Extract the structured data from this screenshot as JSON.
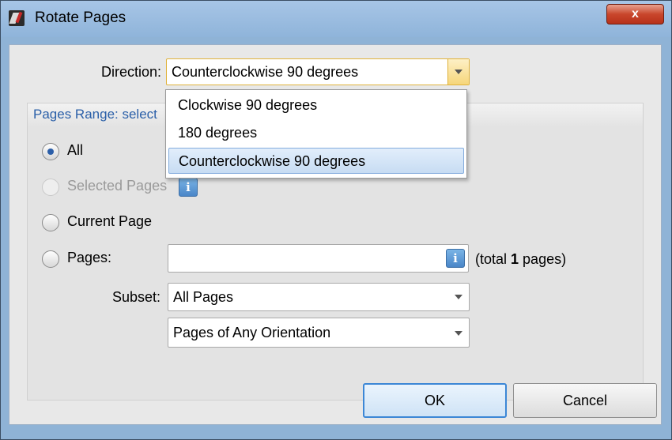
{
  "window": {
    "title": "Rotate Pages",
    "close_label": "x"
  },
  "direction": {
    "label": "Direction:",
    "value": "Counterclockwise 90 degrees",
    "options": [
      "Clockwise 90 degrees",
      "180 degrees",
      "Counterclockwise 90 degrees"
    ],
    "selected_index": 2
  },
  "pages_range": {
    "title": "Pages Range: select",
    "options": {
      "all": "All",
      "selected_pages": "Selected Pages",
      "current_page": "Current Page",
      "pages": "Pages:"
    },
    "checked": "all",
    "pages_input_value": "",
    "total_prefix": "(total ",
    "total_count": "1",
    "total_suffix": " pages)",
    "info_glyph": "i"
  },
  "subset": {
    "label": "Subset:",
    "value": "All Pages",
    "orientation_value": "Pages of Any Orientation"
  },
  "buttons": {
    "ok": "OK",
    "cancel": "Cancel"
  },
  "colors": {
    "accent": "#3c87d6",
    "group_title": "#2a5fa8",
    "close_button": "#c9462c"
  }
}
